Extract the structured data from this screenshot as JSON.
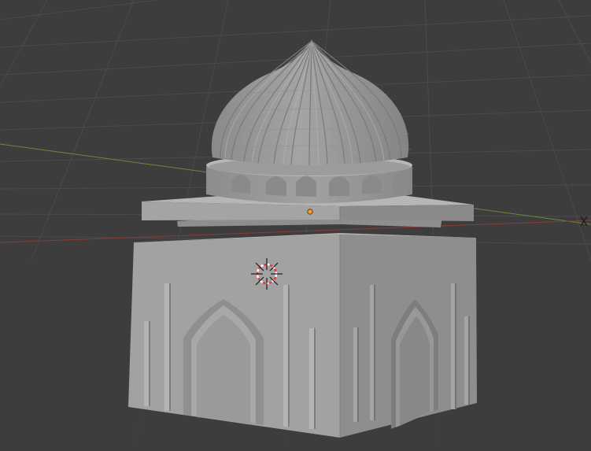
{
  "viewport": {
    "background": "#3d3d3d",
    "grid_color": "#4a4a4a",
    "x_axis_color": "#8a3b3b",
    "y_axis_color": "#6a8a3a",
    "model_color": "#9a9a9a",
    "origin_color": "#ff9a1a",
    "cursor_colors": [
      "#e23b3b",
      "#ffffff"
    ],
    "cursor_icon": "3d-cursor-icon",
    "origin_icon": "object-origin-dot-icon"
  }
}
